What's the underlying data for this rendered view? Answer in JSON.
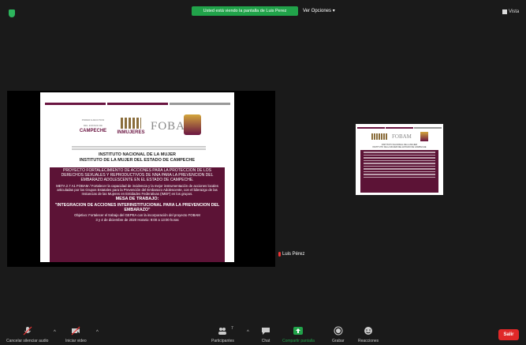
{
  "topbar": {
    "share_banner": "Usted está viendo la pantalla de Luis Perez",
    "view_options": "Ver Opciones",
    "view_options_caret": "▾",
    "view_toggle": "Vista"
  },
  "slide": {
    "logo_campeche_1": "PODER EJECUTIVO",
    "logo_campeche_2": "DEL ESTADO DE",
    "logo_campeche_3": "CAMPECHE",
    "logo_inmujeres": "INMUJERES",
    "logo_fobam": "FOBAM",
    "institute_1": "INSTITUTO NACIONAL DE LA MUJER",
    "institute_2": "INSTITUTO DE LA MUJER DEL ESTADO DE CAMPECHE",
    "project": "PROYECTO FORTALECIMIENTO DE ACCIONES PARA LA PROTECCION DE LOS DERECHOS SEXUALES Y REPRODUCTIVOS DE NNA PARA LA PREVENCION DEL EMBARAZO ADOLESCENTE EN EL ESTADO DE CAMPECHE.",
    "goal": "META 2.7 A1 FOBAM / Fortalecer la capacidad de incidencia y la mejor instrumentación de acciones locales articuladas por los Grupos Estatales para la Prevención del Embarazo Adolescente, con el liderazgo de las Instancias de las Mujeres en Entidades Federativas (IMEF) en los grupos.",
    "table": "MESA DE TRABAJO:",
    "topic": "\"INTEGRACION DE ACCIONES INTERINSTITUCIONAL PARA LA PREVENCION DEL EMBARAZO\"",
    "objective": "Objetivo: Fortalecer el trabajo del GEPEA con la incorporación del proyecto FOBAM",
    "date": "3 y 4 de diciembre de 2020   Horario: 9:00 a 13:00 horas"
  },
  "participant": {
    "name": "Luis Pérez"
  },
  "toolbar": {
    "audio": "Cancelar silenciar audio",
    "video": "Iniciar video",
    "participants": "Participantes",
    "participants_count": "7",
    "chat": "Chat",
    "share": "Compartir pantalla",
    "record": "Grabar",
    "reactions": "Reacciones",
    "caret": "^",
    "leave": "Salir"
  },
  "colors": {
    "share_green": "#21a34a",
    "leave_red": "#e02828",
    "slide_band": "#5c1336",
    "background": "#1a1a1a"
  }
}
